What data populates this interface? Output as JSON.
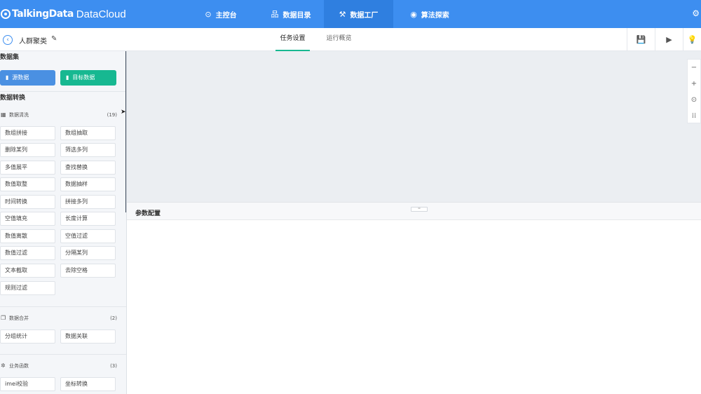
{
  "header": {
    "logo_strong": "TalkingData",
    "logo_light": "DataCloud",
    "nav": [
      {
        "label": "主控台",
        "icon": "⊙"
      },
      {
        "label": "数据目录",
        "icon": "品"
      },
      {
        "label": "数据工厂",
        "icon": "⚒"
      },
      {
        "label": "算法探索",
        "icon": "◉"
      }
    ],
    "settings_icon": "⚙"
  },
  "subheader": {
    "project_title": "人群聚类",
    "tabs": [
      {
        "label": "任务设置"
      },
      {
        "label": "运行概览"
      }
    ],
    "tools": [
      "💾",
      "▶",
      "💡"
    ]
  },
  "sidebar": {
    "dataset_title": "数据集",
    "source_btn": "源数据",
    "target_btn": "目标数据",
    "transform_title": "数据转换",
    "groups": [
      {
        "label": "数据清洗",
        "count": "(19)",
        "icon": "▦",
        "items": [
          "数组拼接",
          "数组抽取",
          "删除某列",
          "筛选多列",
          "多值展平",
          "查找替换",
          "数值取整",
          "数据抽样",
          "时间转换",
          "拼接多列",
          "空值填充",
          "长度计算",
          "数值离散",
          "空值过滤",
          "数值过滤",
          "分隔某列",
          "文本截取",
          "去除空格",
          "规则过滤"
        ]
      },
      {
        "label": "数据合并",
        "count": "(2)",
        "icon": "❐",
        "items": [
          "分组统计",
          "数据关联"
        ]
      },
      {
        "label": "业务函数",
        "count": "(3)",
        "icon": "✲",
        "items": [
          "imei校验",
          "坐标转换"
        ]
      }
    ]
  },
  "canvas": {
    "zoom_controls": [
      "−",
      "+",
      "⊙",
      "⁞⁞"
    ]
  },
  "params": {
    "title": "参数配置",
    "handle": "═"
  },
  "colors": {
    "header_bg": "#3d8ef0",
    "source_btn": "#4a90e2",
    "target_btn": "#17b891",
    "tab_underline": "#17b891"
  }
}
